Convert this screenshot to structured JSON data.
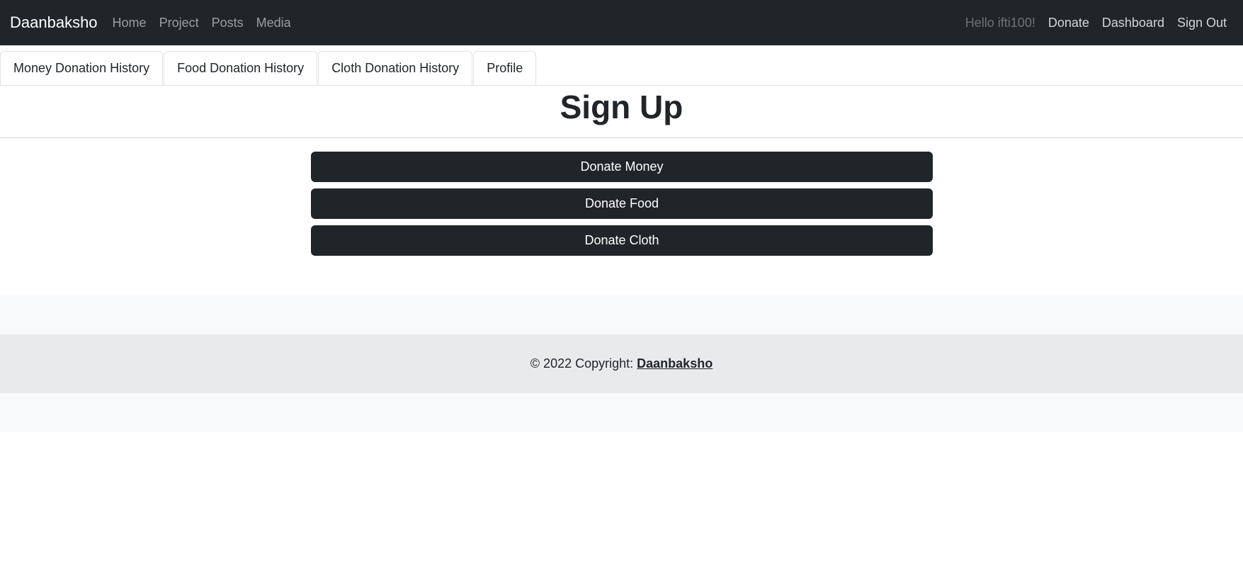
{
  "navbar": {
    "brand": "Daanbaksho",
    "links": [
      "Home",
      "Project",
      "Posts",
      "Media"
    ],
    "greeting": "Hello ifti100!",
    "right_links": [
      "Donate",
      "Dashboard",
      "Sign Out"
    ]
  },
  "tabs": [
    "Money Donation History",
    "Food Donation History",
    "Cloth Donation History",
    "Profile"
  ],
  "page": {
    "title": "Sign Up"
  },
  "actions": {
    "donate_money": "Donate Money",
    "donate_food": "Donate Food",
    "donate_cloth": "Donate Cloth"
  },
  "footer": {
    "copyright": "© 2022 Copyright:",
    "link": "Daanbaksho"
  },
  "colors": {
    "navbar_bg": "#212529",
    "button_bg": "#212529",
    "footer_bg": "#f8f9fa",
    "footer_copy_bg": "#e9eaec"
  }
}
